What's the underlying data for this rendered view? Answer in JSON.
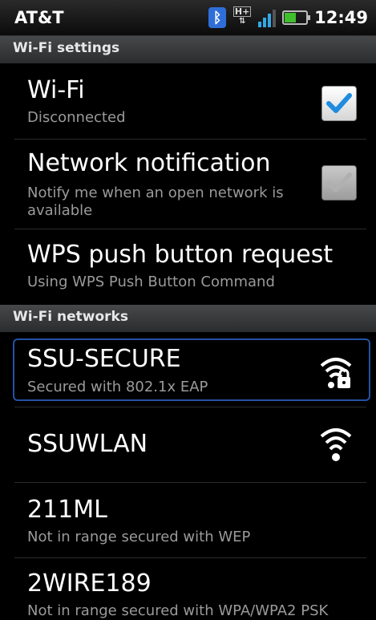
{
  "status_bar": {
    "carrier": "AT&T",
    "time": "12:49",
    "network_type": "H+",
    "icons": [
      "bluetooth-icon",
      "h-plus-data-icon",
      "signal-strength-icon",
      "battery-icon"
    ],
    "battery_level": 0.5,
    "colors": {
      "bluetooth": "#2f6ed8",
      "signal": "#34a7e6",
      "battery": "#3fbf2c"
    }
  },
  "wifi_settings_header": "Wi-Fi settings",
  "wifi": {
    "title": "Wi-Fi",
    "summary": "Disconnected",
    "checked": true
  },
  "network_notification": {
    "title": "Network notification",
    "summary": "Notify me when an open network is available",
    "checked": true,
    "enabled": false
  },
  "wps": {
    "title": "WPS push button request",
    "summary": "Using WPS Push Button Command"
  },
  "wifi_networks_header": "Wi-Fi networks",
  "networks": [
    {
      "ssid": "SSU-SECURE",
      "summary": "Secured with 802.1x EAP",
      "icon": "wifi-lock-icon",
      "selected": true
    },
    {
      "ssid": "SSUWLAN",
      "summary": "",
      "icon": "wifi-icon",
      "selected": false
    },
    {
      "ssid": "211ML",
      "summary": "Not in range secured with WEP"
    },
    {
      "ssid": "2WIRE189",
      "summary": "Not in range secured with WPA/WPA2 PSK"
    }
  ]
}
